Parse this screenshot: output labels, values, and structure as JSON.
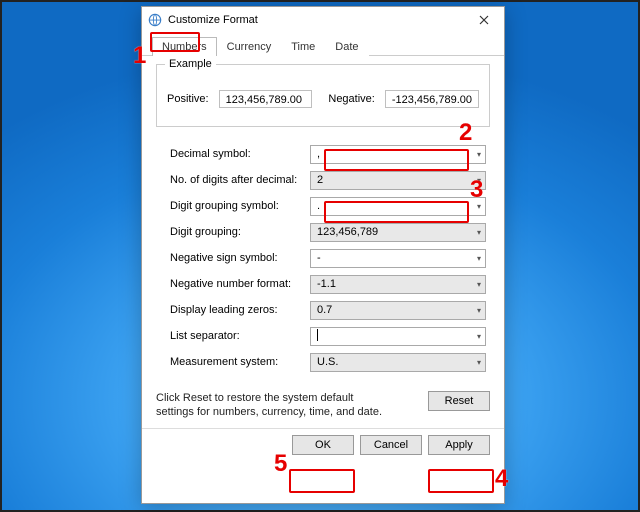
{
  "title": "Customize Format",
  "tabs": [
    "Numbers",
    "Currency",
    "Time",
    "Date"
  ],
  "example": {
    "caption": "Example",
    "pos_label": "Positive:",
    "pos_value": "123,456,789.00",
    "neg_label": "Negative:",
    "neg_value": "-123,456,789.00"
  },
  "fields": {
    "decimal_symbol": {
      "label": "Decimal symbol:",
      "value": ","
    },
    "digits_after": {
      "label": "No. of digits after decimal:",
      "value": "2"
    },
    "grouping_symbol": {
      "label": "Digit grouping symbol:",
      "value": "."
    },
    "digit_grouping": {
      "label": "Digit grouping:",
      "value": "123,456,789"
    },
    "neg_sign": {
      "label": "Negative sign symbol:",
      "value": "-"
    },
    "neg_format": {
      "label": "Negative number format:",
      "value": "-1.1"
    },
    "leading_zeros": {
      "label": "Display leading zeros:",
      "value": "0.7"
    },
    "list_separator": {
      "label": "List separator:",
      "value": ""
    },
    "measurement": {
      "label": "Measurement system:",
      "value": "U.S."
    }
  },
  "note": "Click Reset to restore the system default settings for numbers, currency, time, and date.",
  "buttons": {
    "reset": "Reset",
    "ok": "OK",
    "cancel": "Cancel",
    "apply": "Apply"
  },
  "ann": {
    "1": "1",
    "2": "2",
    "3": "3",
    "4": "4",
    "5": "5"
  }
}
